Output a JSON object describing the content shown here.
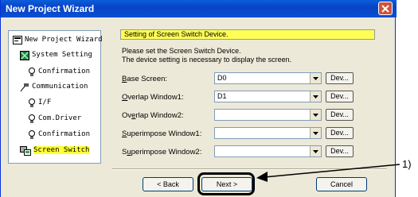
{
  "window": {
    "title": "New Project Wizard"
  },
  "tree": {
    "items": [
      {
        "label": "New Project Wizard",
        "icon": "wizard-icon"
      },
      {
        "label": "System Setting",
        "icon": "system-setting-icon"
      },
      {
        "label": "Confirmation",
        "icon": "bulb-icon"
      },
      {
        "label": "Communication",
        "icon": "communication-icon"
      },
      {
        "label": "I/F",
        "icon": "bulb-icon"
      },
      {
        "label": "Com.Driver",
        "icon": "bulb-icon"
      },
      {
        "label": "Confirmation",
        "icon": "bulb-icon"
      },
      {
        "label": "Screen Switch",
        "icon": "screen-switch-icon",
        "selected": true
      }
    ]
  },
  "panel": {
    "header": "Setting of Screen Switch Device.",
    "desc_line1": "Please set the Screen Switch Device.",
    "desc_line2": "The device setting is necessary to display the screen.",
    "rows": [
      {
        "label_key": "B",
        "label_rest": "ase Screen:",
        "value": "D0",
        "dev": "Dev..."
      },
      {
        "label_key": "O",
        "label_rest": "verlap Window1:",
        "value": "D1",
        "dev": "Dev..."
      },
      {
        "label_pre": "Ov",
        "label_key": "e",
        "label_rest": "rlap Window2:",
        "value": "",
        "dev": "Dev..."
      },
      {
        "label_key": "S",
        "label_rest": "uperimpose Window1:",
        "value": "",
        "dev": "Dev..."
      },
      {
        "label_pre": "S",
        "label_key": "u",
        "label_rest": "perimpose Window2:",
        "value": "",
        "dev": "Dev..."
      }
    ]
  },
  "buttons": {
    "back": "< Back",
    "next": "Next >",
    "cancel": "Cancel"
  },
  "callout": {
    "label": "1)"
  },
  "colors": {
    "title_bar": "#0a5fd8",
    "header_highlight": "#ffff55",
    "selected_highlight": "#ffff33",
    "close_button": "#d2513a"
  }
}
